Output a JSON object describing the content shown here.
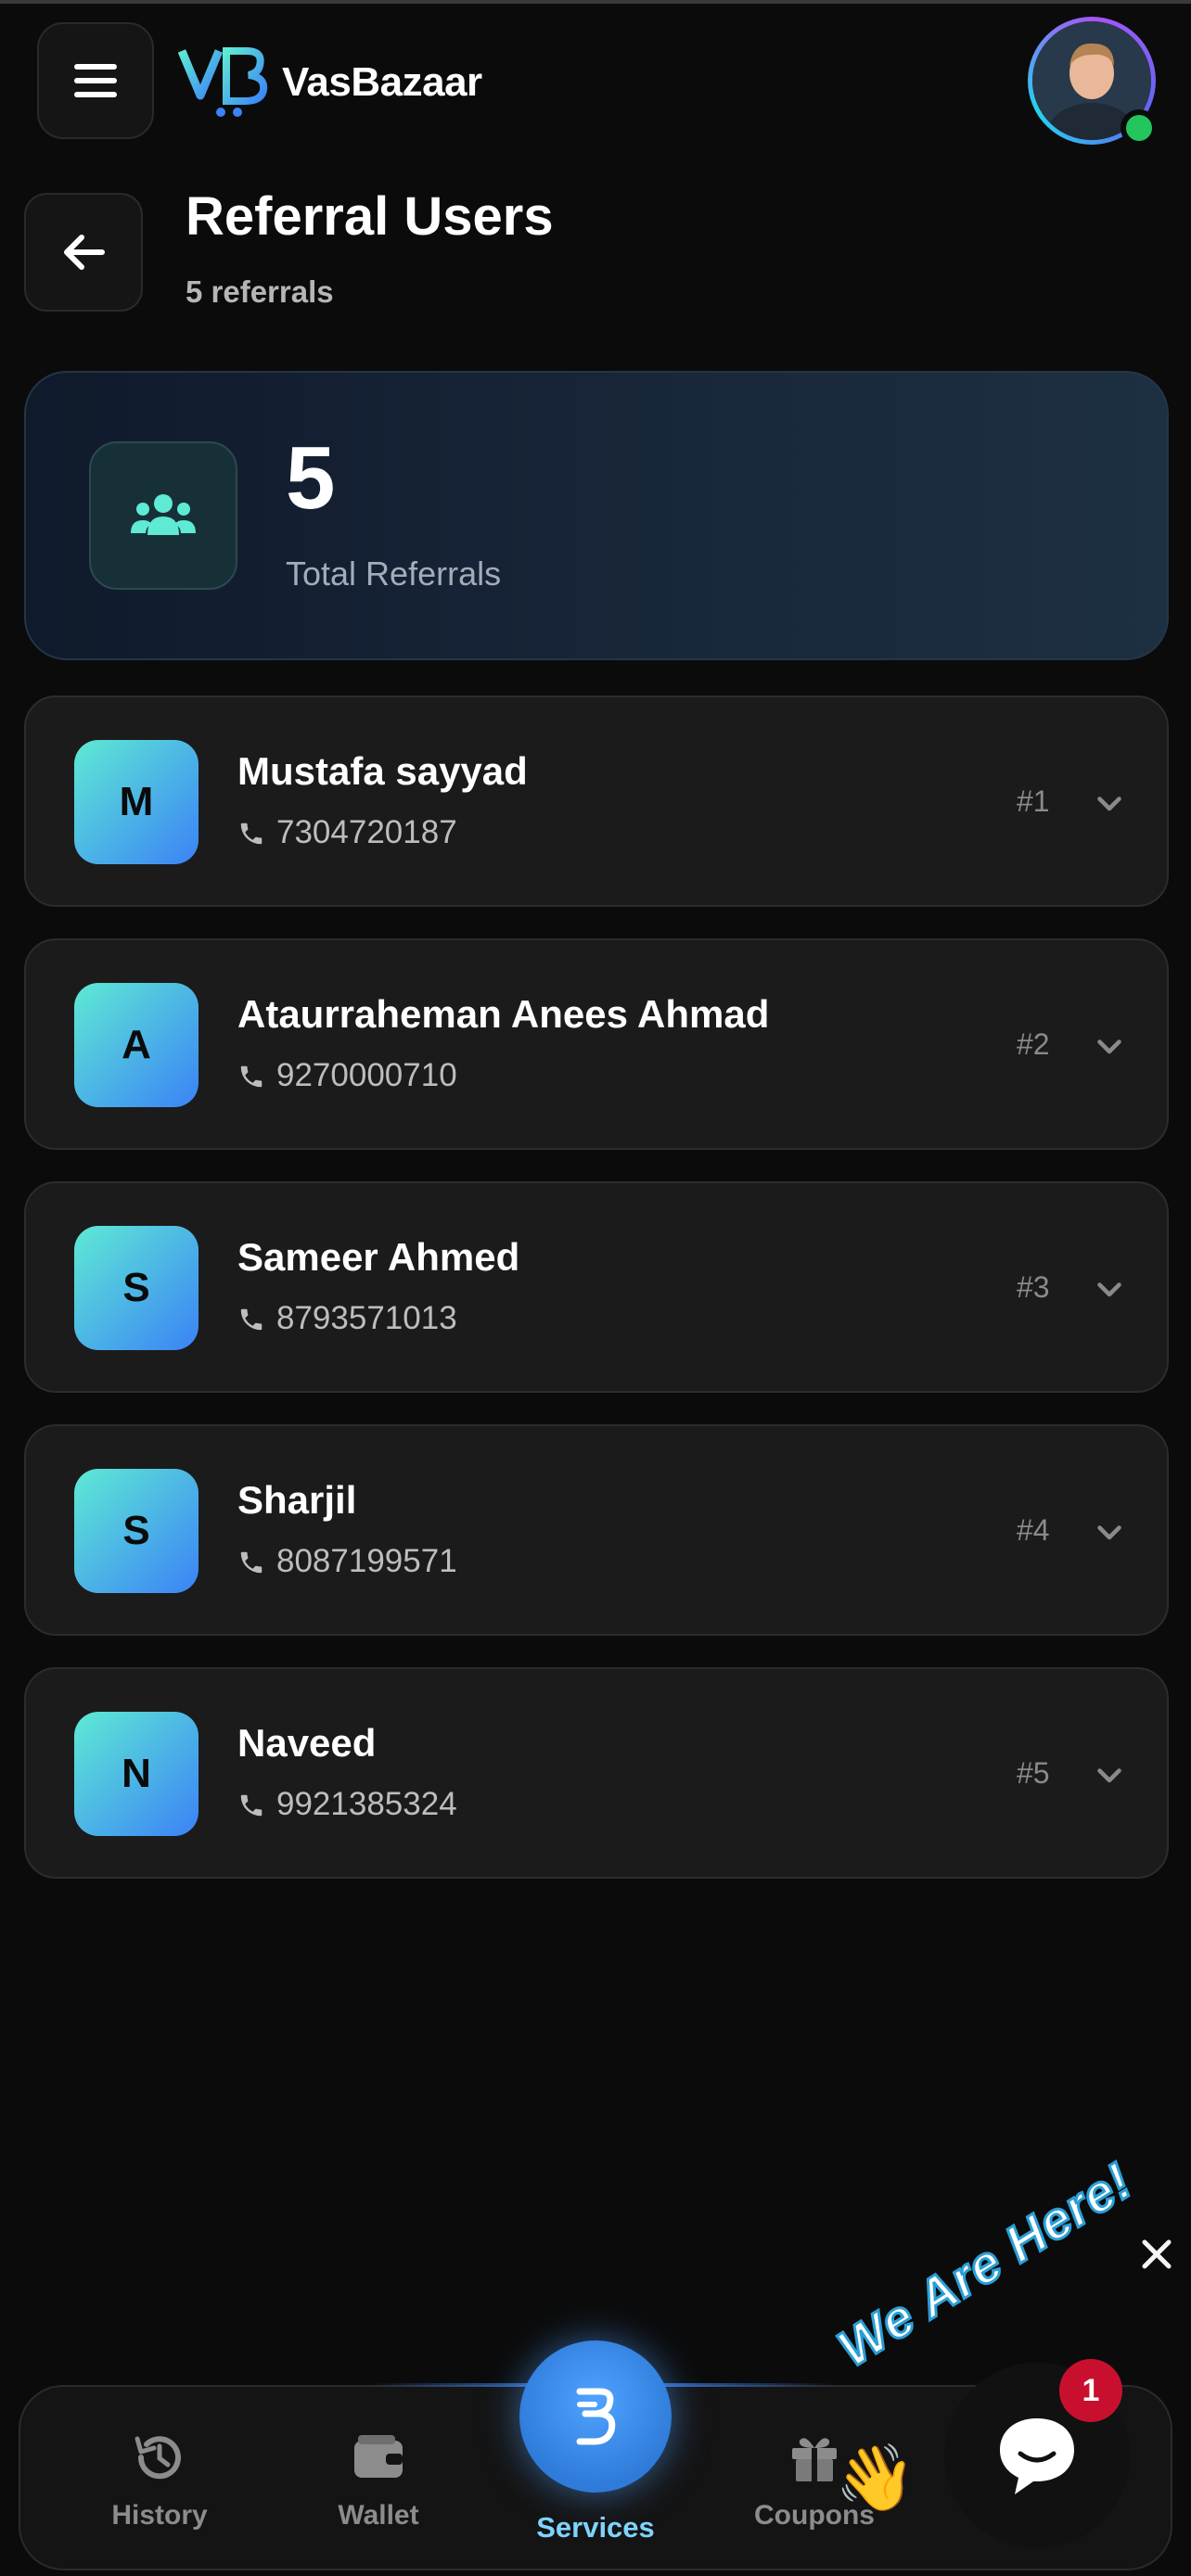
{
  "app": {
    "logo_text": "VasBazaar"
  },
  "header": {
    "title": "Referral Users",
    "subtitle": "5 referrals"
  },
  "stats": {
    "value": "5",
    "label": "Total Referrals"
  },
  "referrals": [
    {
      "initial": "M",
      "name": "Mustafa sayyad",
      "phone": "7304720187",
      "rank": "#1"
    },
    {
      "initial": "A",
      "name": "Ataurraheman Anees Ahmad",
      "phone": "9270000710",
      "rank": "#2"
    },
    {
      "initial": "S",
      "name": "Sameer Ahmed",
      "phone": "8793571013",
      "rank": "#3"
    },
    {
      "initial": "S",
      "name": "Sharjil",
      "phone": "8087199571",
      "rank": "#4"
    },
    {
      "initial": "N",
      "name": "Naveed",
      "phone": "9921385324",
      "rank": "#5"
    }
  ],
  "nav": {
    "history": "History",
    "wallet": "Wallet",
    "services": "Services",
    "coupons": "Coupons",
    "livechat": "Livechat"
  },
  "chat": {
    "tag": "We Are Here!",
    "badge": "1"
  },
  "colors": {
    "accent": "#5eead4",
    "avatar_gradient_end": "#3b82f6",
    "online": "#22c55e",
    "badge": "#c8102e"
  }
}
